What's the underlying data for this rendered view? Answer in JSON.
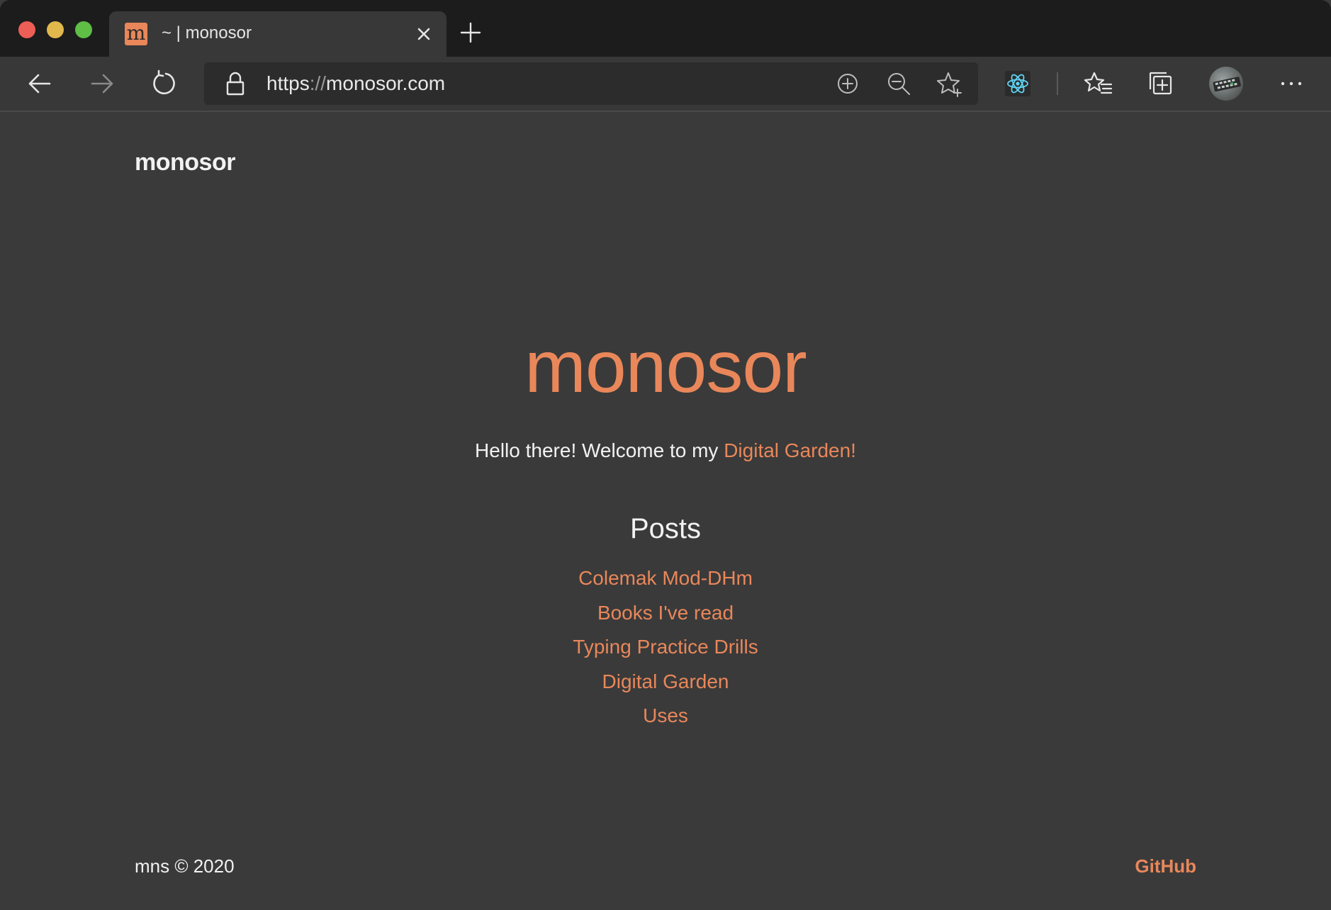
{
  "browser": {
    "tab": {
      "favicon_glyph": "m",
      "title": "~ | monosor"
    },
    "address": {
      "scheme": "https",
      "separator": "://",
      "host": "monosor.com"
    },
    "icons": {
      "back": "arrow-left-icon",
      "forward": "arrow-right-icon",
      "reload": "reload-icon",
      "lock": "lock-icon",
      "add_page": "add-circle-icon",
      "zoom": "zoom-out-icon",
      "favorite": "star-add-icon",
      "extension": "react-devtools-icon",
      "favorites": "favorites-list-icon",
      "collections": "collections-icon",
      "profile": "avatar",
      "more": "more-icon"
    }
  },
  "site": {
    "brand": "monosor",
    "hero_title": "monosor",
    "welcome_text": "Hello there! Welcome to my ",
    "welcome_link": "Digital Garden!",
    "posts_heading": "Posts",
    "posts": [
      "Colemak Mod-DHm",
      "Books I've read",
      "Typing Practice Drills",
      "Digital Garden",
      "Uses"
    ],
    "footer_left": "mns © 2020",
    "footer_right": "GitHub"
  },
  "colors": {
    "accent": "#e9875a",
    "page_background": "#3a3a3a",
    "chrome_dark": "#1c1c1c",
    "text": "#f2f2f2"
  }
}
